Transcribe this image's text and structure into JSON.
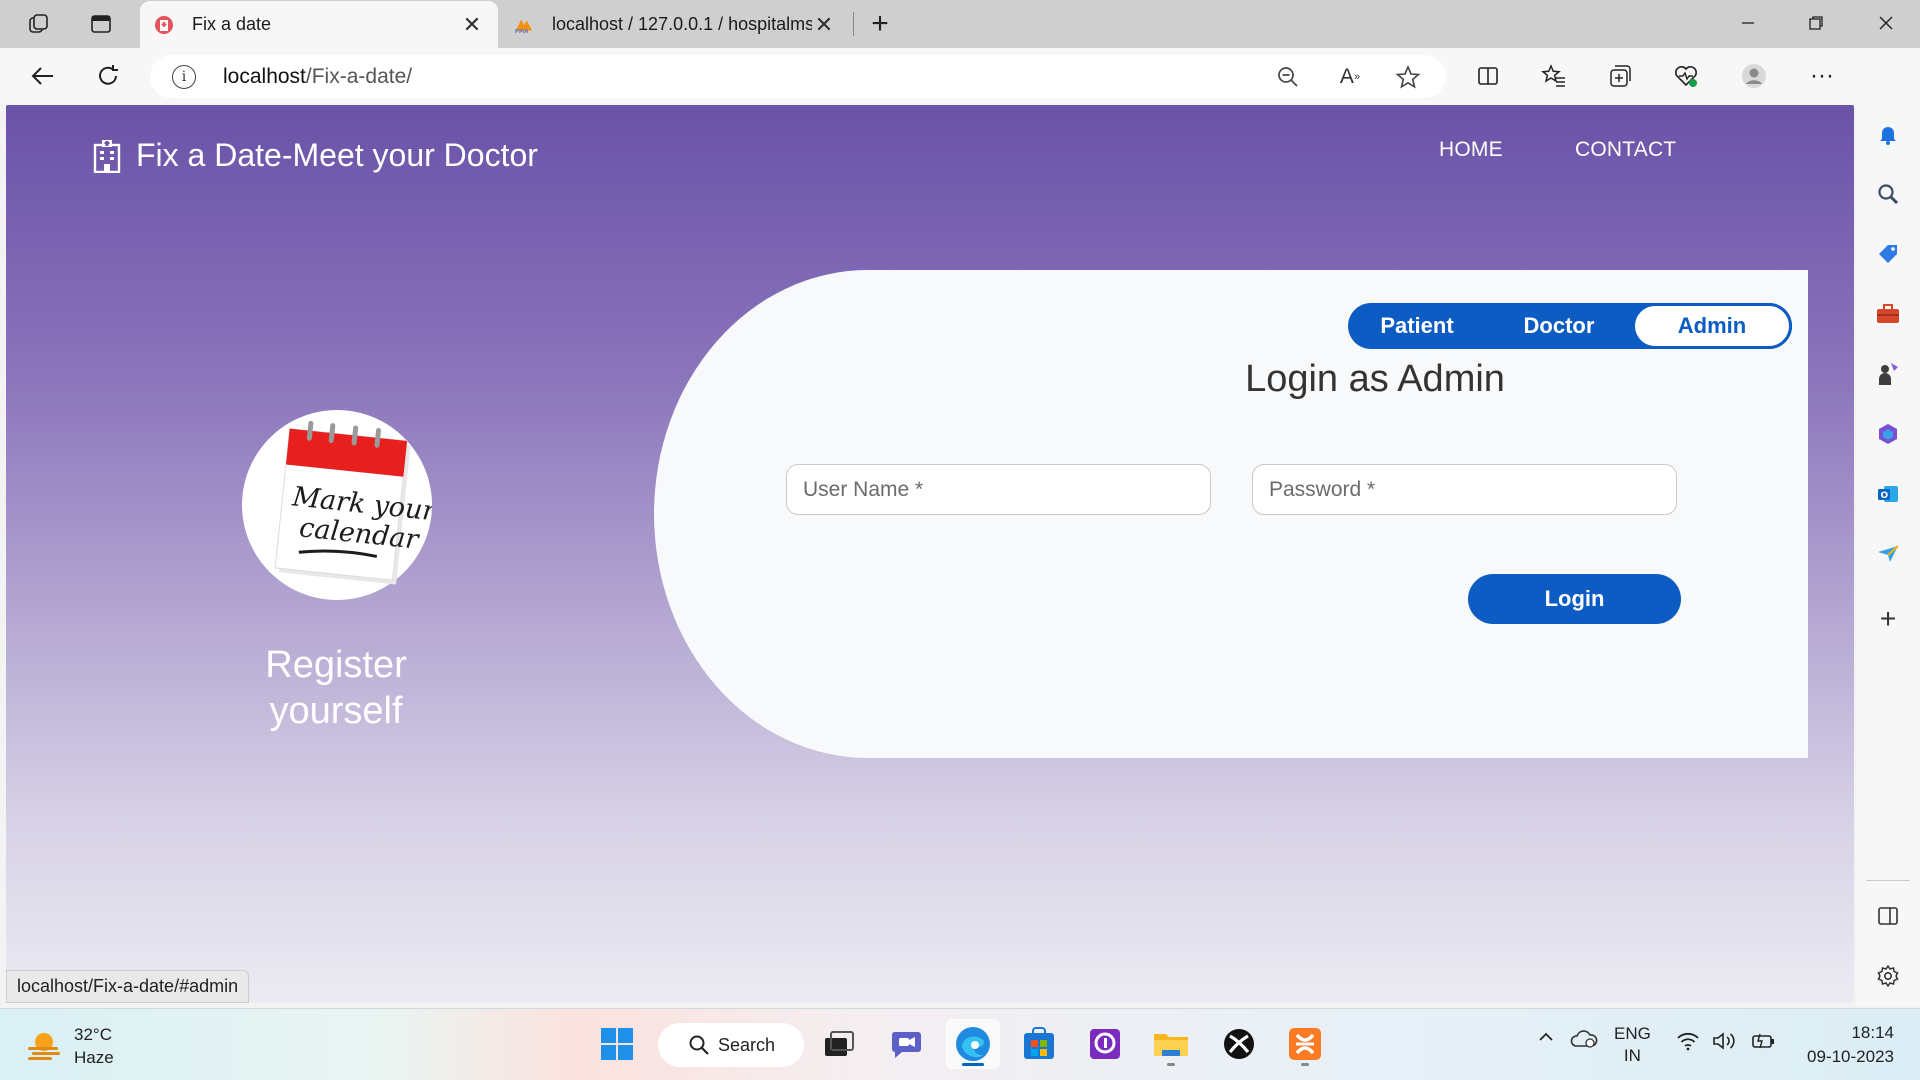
{
  "browser": {
    "tabs": [
      {
        "title": "Fix a date",
        "active": true,
        "icon": "hospital-favicon"
      },
      {
        "title": "localhost / 127.0.0.1 / hospitalms",
        "active": false,
        "icon": "phpmyadmin-favicon"
      }
    ],
    "address": {
      "host": "localhost",
      "path": "/Fix-a-date/"
    },
    "status_url": "localhost/Fix-a-date/#admin"
  },
  "site": {
    "brand": "Fix a Date-Meet your Doctor",
    "nav": [
      "HOME",
      "CONTACT"
    ],
    "left_panel": {
      "calendar_text_1": "Mark your",
      "calendar_text_2": "calendar",
      "register_line_1": "Register",
      "register_line_2": "yourself"
    },
    "login": {
      "roles": [
        "Patient",
        "Doctor",
        "Admin"
      ],
      "selected_role": "Admin",
      "title": "Login as Admin",
      "username_placeholder": "User Name *",
      "password_placeholder": "Password *",
      "button": "Login"
    }
  },
  "taskbar": {
    "weather": {
      "temp": "32°C",
      "condition": "Haze"
    },
    "search_label": "Search",
    "lang_1": "ENG",
    "lang_2": "IN",
    "time": "18:14",
    "date": "09-10-2023"
  },
  "colors": {
    "accent": "#0c5cc4",
    "header_purple": "#6a53a8",
    "card": "#f8f9fa"
  }
}
